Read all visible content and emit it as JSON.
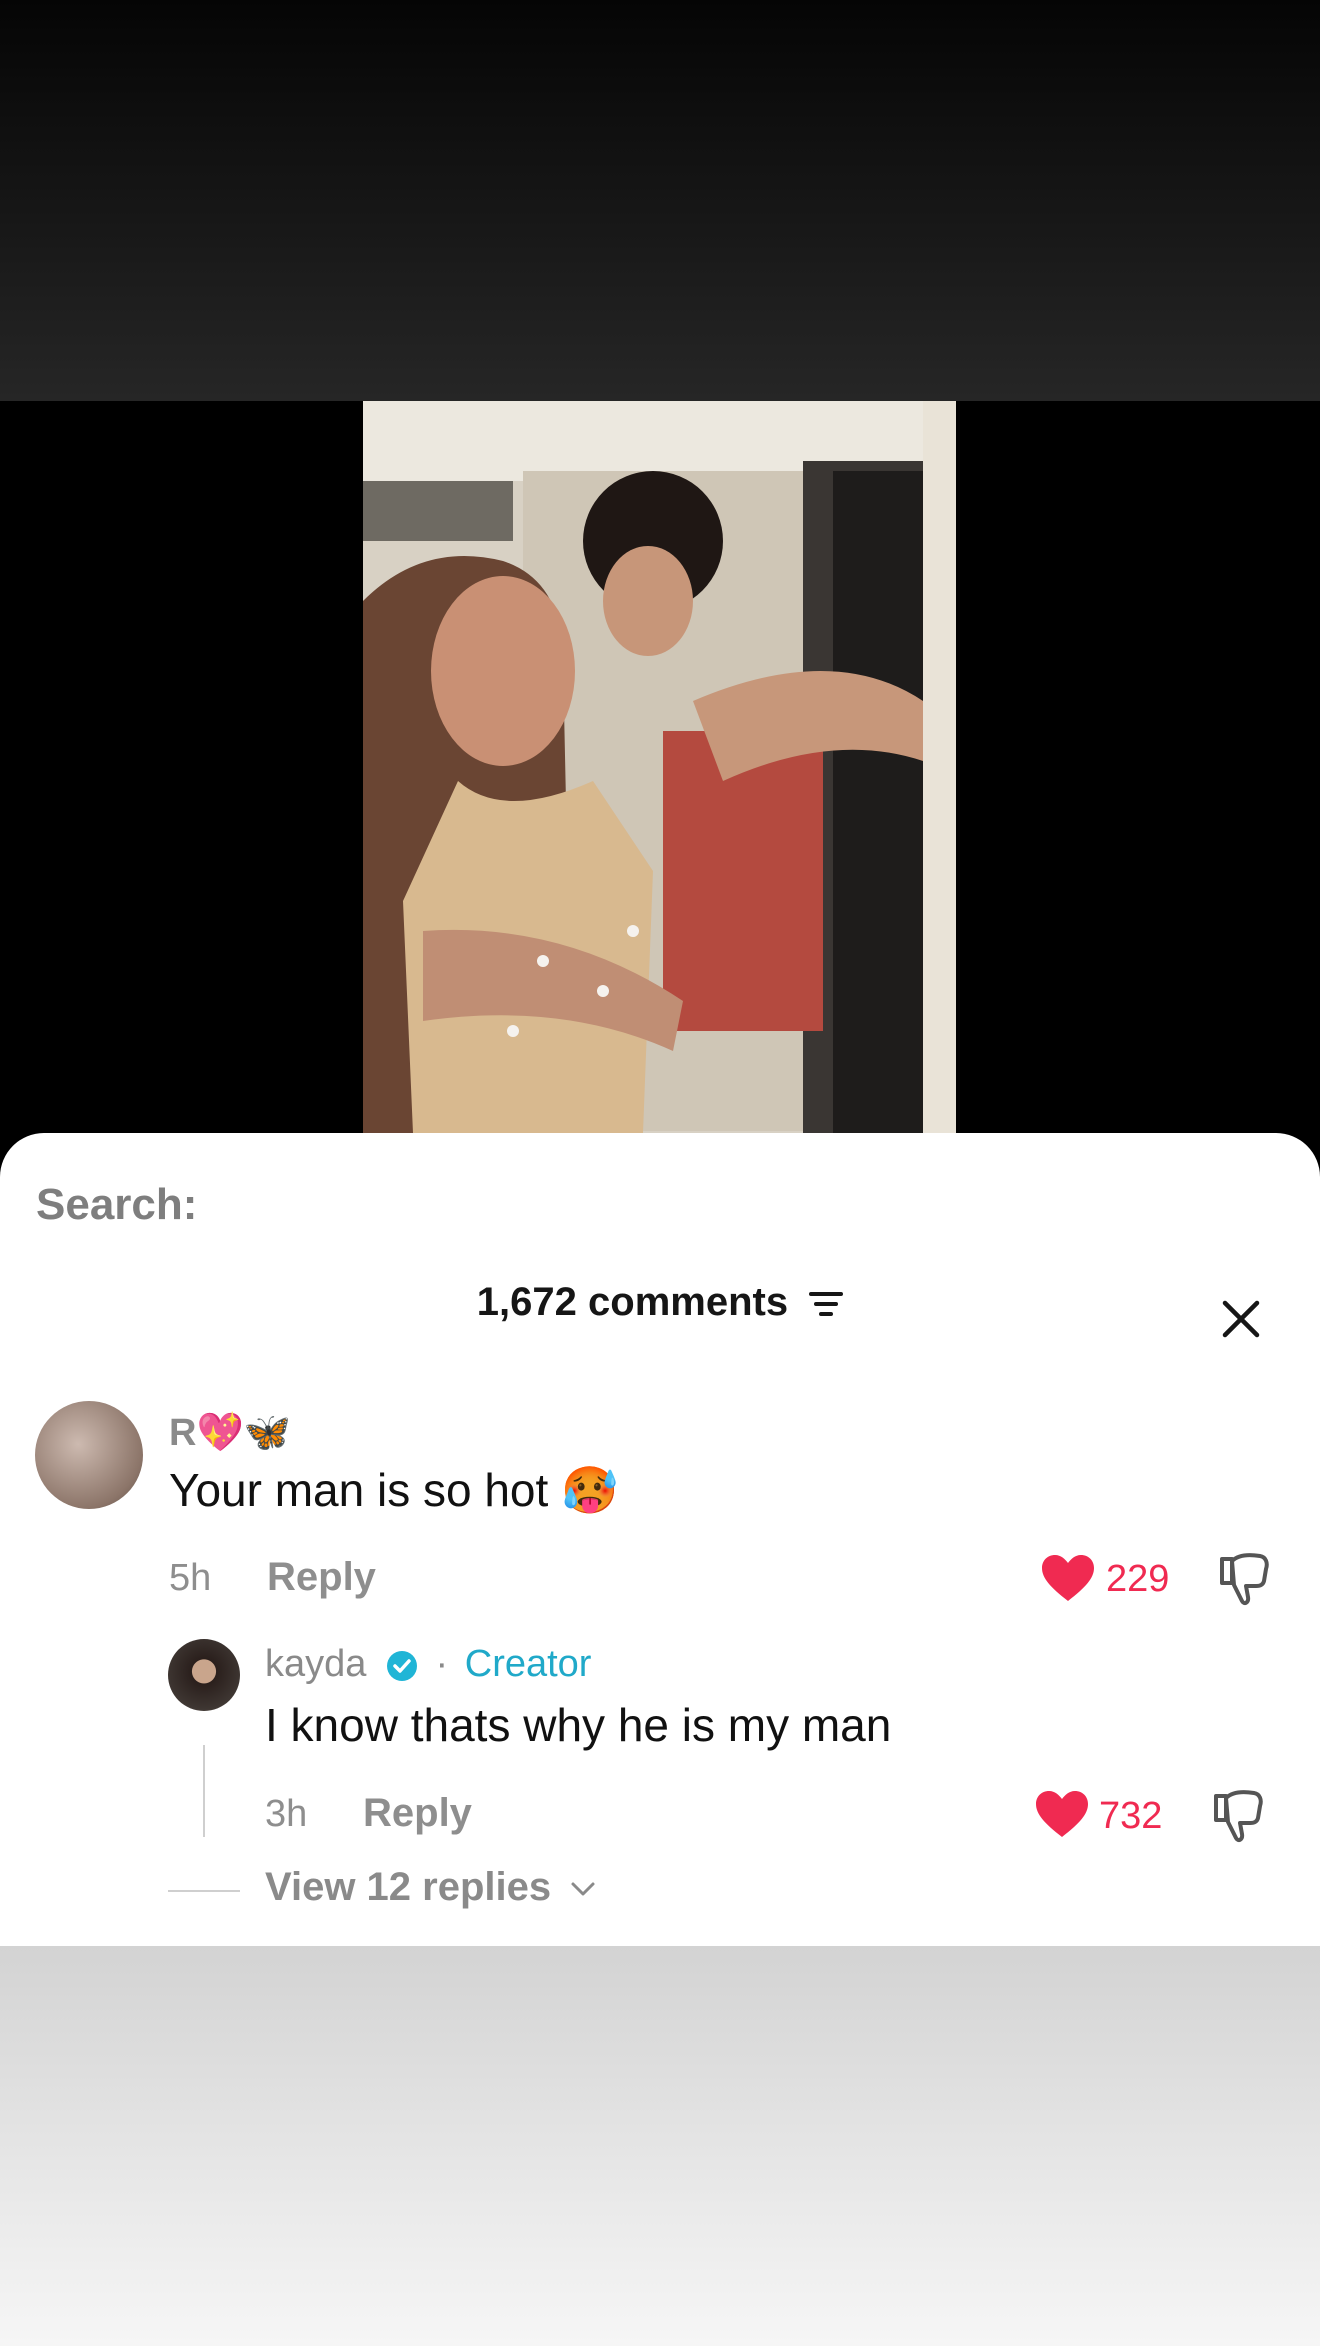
{
  "search": {
    "label": "Search:"
  },
  "comments": {
    "count_label": "1,672 comments",
    "items": [
      {
        "username": "R💖🦋",
        "text": "Your man is so hot 🥵",
        "time": "5h",
        "reply_label": "Reply",
        "likes": "229",
        "liked": true
      },
      {
        "username": "kayda",
        "separator": "·",
        "badge": "Creator",
        "text": "I know thats why he is my man",
        "time": "3h",
        "reply_label": "Reply",
        "likes": "732",
        "liked": true
      }
    ],
    "view_replies_label": "View 12 replies"
  },
  "colors": {
    "like": "#f02a51",
    "creator": "#20a9c9",
    "verified": "#20b5d6"
  }
}
